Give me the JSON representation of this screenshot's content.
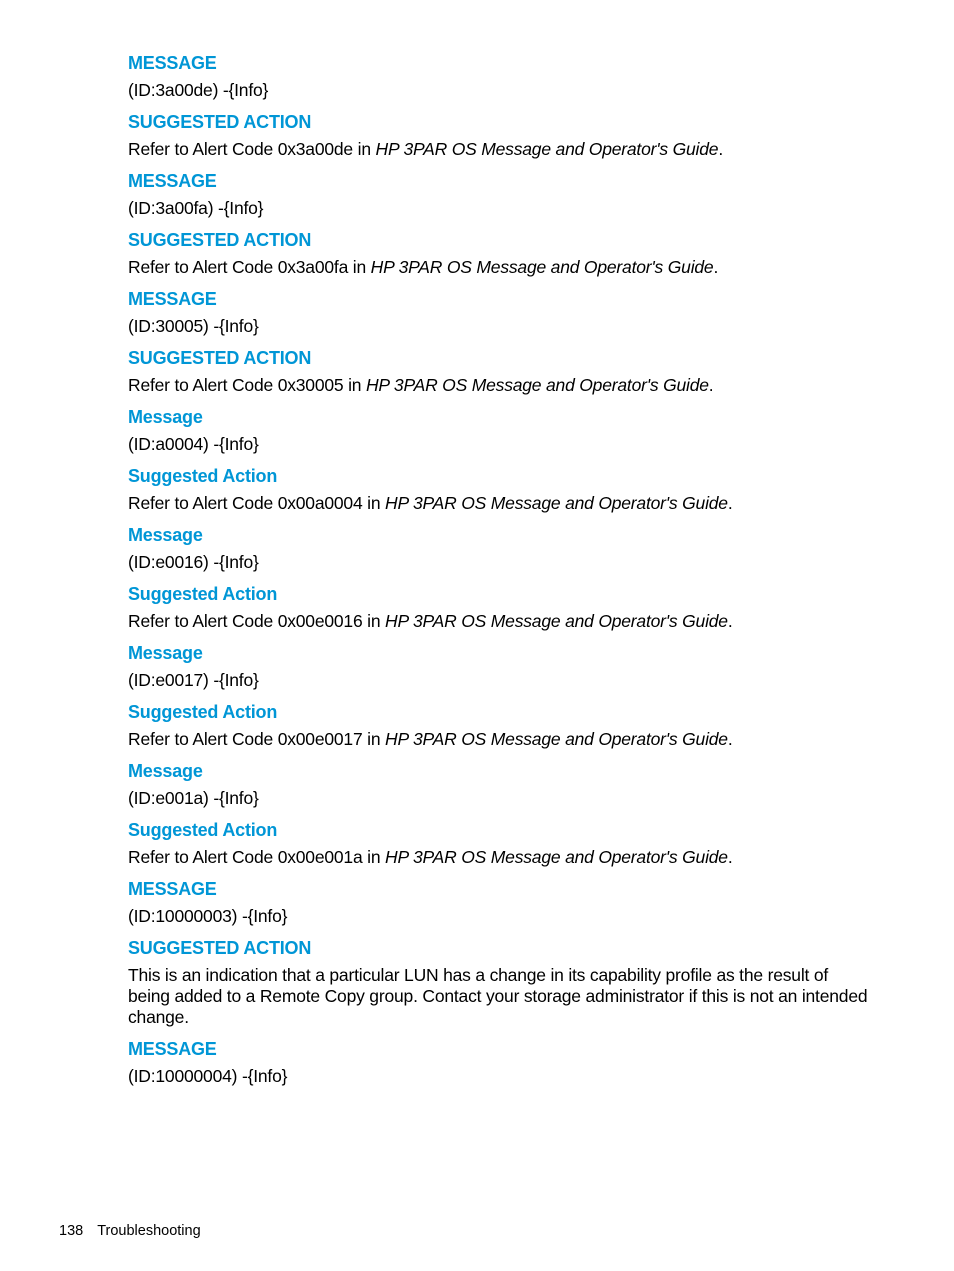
{
  "blocks": [
    {
      "heading": "MESSAGE",
      "text": "(ID:3a00de) -{Info}"
    },
    {
      "heading": "SUGGESTED ACTION",
      "prefix": "Refer to Alert Code 0x3a00de in ",
      "italic": "HP 3PAR OS Message and Operator's Guide",
      "suffix": "."
    },
    {
      "heading": "MESSAGE",
      "text": "(ID:3a00fa) -{Info}"
    },
    {
      "heading": "SUGGESTED ACTION",
      "prefix": "Refer to Alert Code 0x3a00fa in ",
      "italic": "HP 3PAR OS Message and Operator's Guide",
      "suffix": "."
    },
    {
      "heading": "MESSAGE",
      "text": "(ID:30005) -{Info}"
    },
    {
      "heading": "SUGGESTED ACTION",
      "prefix": "Refer to Alert Code 0x30005 in ",
      "italic": "HP 3PAR OS Message and Operator's Guide",
      "suffix": "."
    },
    {
      "heading": "Message",
      "text": "(ID:a0004) -{Info}"
    },
    {
      "heading": "Suggested Action",
      "prefix": "Refer to Alert Code 0x00a0004 in ",
      "italic": "HP 3PAR OS Message and Operator's Guide",
      "suffix": "."
    },
    {
      "heading": "Message",
      "text": "(ID:e0016) -{Info}"
    },
    {
      "heading": "Suggested Action",
      "prefix": "Refer to Alert Code 0x00e0016 in ",
      "italic": "HP 3PAR OS Message and Operator's Guide",
      "suffix": "."
    },
    {
      "heading": "Message",
      "text": "(ID:e0017) -{Info}"
    },
    {
      "heading": "Suggested Action",
      "prefix": "Refer to Alert Code 0x00e0017 in ",
      "italic": "HP 3PAR OS Message and Operator's Guide",
      "suffix": "."
    },
    {
      "heading": "Message",
      "text": "(ID:e001a) -{Info}"
    },
    {
      "heading": "Suggested Action",
      "prefix": "Refer to Alert Code 0x00e001a in ",
      "italic": "HP 3PAR OS Message and Operator's Guide",
      "suffix": "."
    },
    {
      "heading": "MESSAGE",
      "text": "(ID:10000003) -{Info}"
    },
    {
      "heading": "SUGGESTED ACTION",
      "text": "This is an indication that a particular LUN has a change in its capability profile as the result of being added to a Remote Copy group. Contact your storage administrator if this is not an intended change."
    },
    {
      "heading": "MESSAGE",
      "text": "(ID:10000004) -{Info}"
    }
  ],
  "footer": {
    "page_number": "138",
    "section": "Troubleshooting"
  },
  "colors": {
    "heading": "#0096d6",
    "text": "#000000"
  }
}
